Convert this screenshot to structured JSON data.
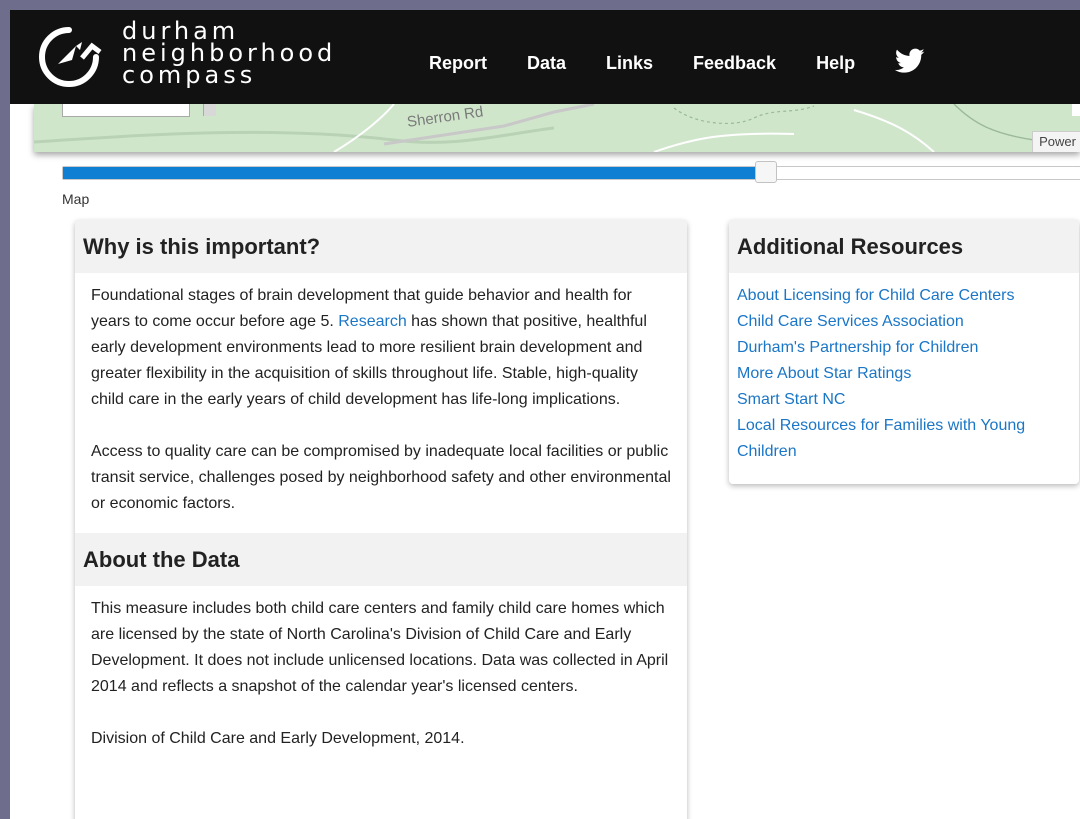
{
  "header": {
    "logo_lines": [
      "durham",
      "neighborhood",
      "compass"
    ],
    "nav": [
      "Report",
      "Data",
      "Links",
      "Feedback",
      "Help"
    ],
    "twitter_icon": "twitter-icon"
  },
  "map": {
    "road_label": "Sherron Rd",
    "powered_label": "Power"
  },
  "slider": {
    "value_percent": 70,
    "label": "Map"
  },
  "why": {
    "title": "Why is this important?",
    "p1_before": "Foundational stages of brain development that guide behavior and health for years to come occur before age 5. ",
    "p1_link": "Research",
    "p1_after": " has shown that positive, healthful early development environments lead to more resilient brain development and greater flexibility in the acquisition of skills throughout life. Stable, high-quality child care in the early years of child development has life-long implications.",
    "p2": "Access to quality care can be compromised by inadequate local facilities or public transit service, challenges posed by neighborhood safety and other environmental or economic factors."
  },
  "about": {
    "title": "About the Data",
    "p1": "This measure includes both child care centers and family child care homes which are licensed by the state of North Carolina's Division of Child Care and Early Development. It does not include unlicensed locations. Data was collected in April 2014 and reflects a snapshot of the calendar year's licensed centers.",
    "p2": "Division of Child Care and Early Development, 2014."
  },
  "resources": {
    "title": "Additional Resources",
    "links": [
      "About Licensing for Child Care Centers",
      "Child Care Services Association",
      "Durham's Partnership for Children",
      "More About Star Ratings",
      "Smart Start NC",
      "Local Resources for Families with Young Children"
    ]
  },
  "colors": {
    "header_bg": "#111111",
    "link": "#1a76c6",
    "slider_fill": "#0f7fd3",
    "map_green": "#cfe6cb"
  }
}
